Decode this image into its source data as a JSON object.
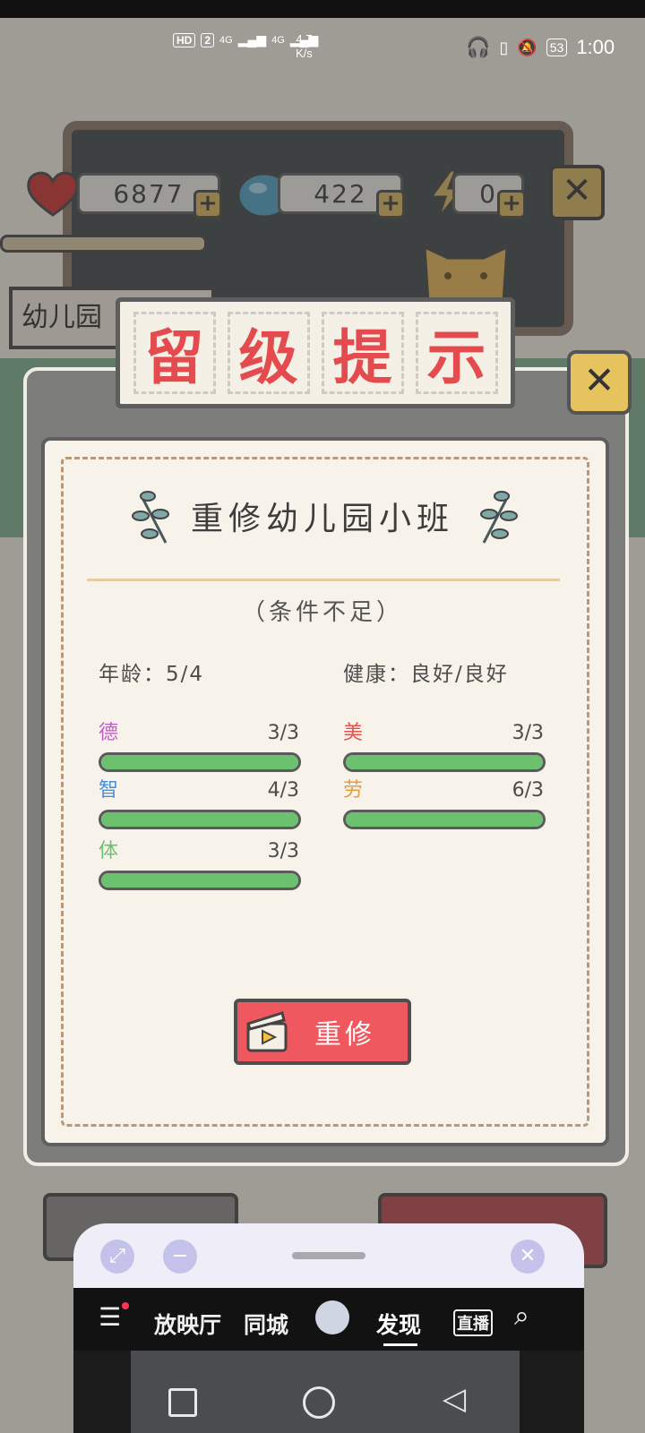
{
  "status_bar": {
    "hd": "HD",
    "sim": "2",
    "net1": "4G",
    "net2": "4G",
    "speed_value": "4.7",
    "speed_unit": "K/s",
    "battery": "53",
    "time": "1:00"
  },
  "resources": {
    "hearts": "6877",
    "gems": "422",
    "energy": "0"
  },
  "background": {
    "sign_text": "幼儿园"
  },
  "dialog": {
    "banner_chars": [
      "留",
      "级",
      "提",
      "示"
    ],
    "title": "重修幼儿园小班",
    "condition": "（条件不足）",
    "age_label": "年龄：5/4",
    "health_label": "健康：良好/良好",
    "stats": [
      {
        "name": "德",
        "value": "3/3",
        "color": "#c35ac9",
        "fill": 1.0
      },
      {
        "name": "智",
        "value": "4/3",
        "color": "#4b8fd8",
        "fill": 1.0
      },
      {
        "name": "体",
        "value": "3/3",
        "color": "#6cc16f",
        "fill": 1.0
      },
      {
        "name": "美",
        "value": "3/3",
        "color": "#e7534f",
        "fill": 1.0
      },
      {
        "name": "劳",
        "value": "6/3",
        "color": "#e3a03c",
        "fill": 1.0
      }
    ],
    "redo_button": "重修"
  },
  "mini_window": {
    "nav": [
      "放映厅",
      "同城",
      "发现",
      "直播"
    ],
    "active_tab": "发现"
  }
}
